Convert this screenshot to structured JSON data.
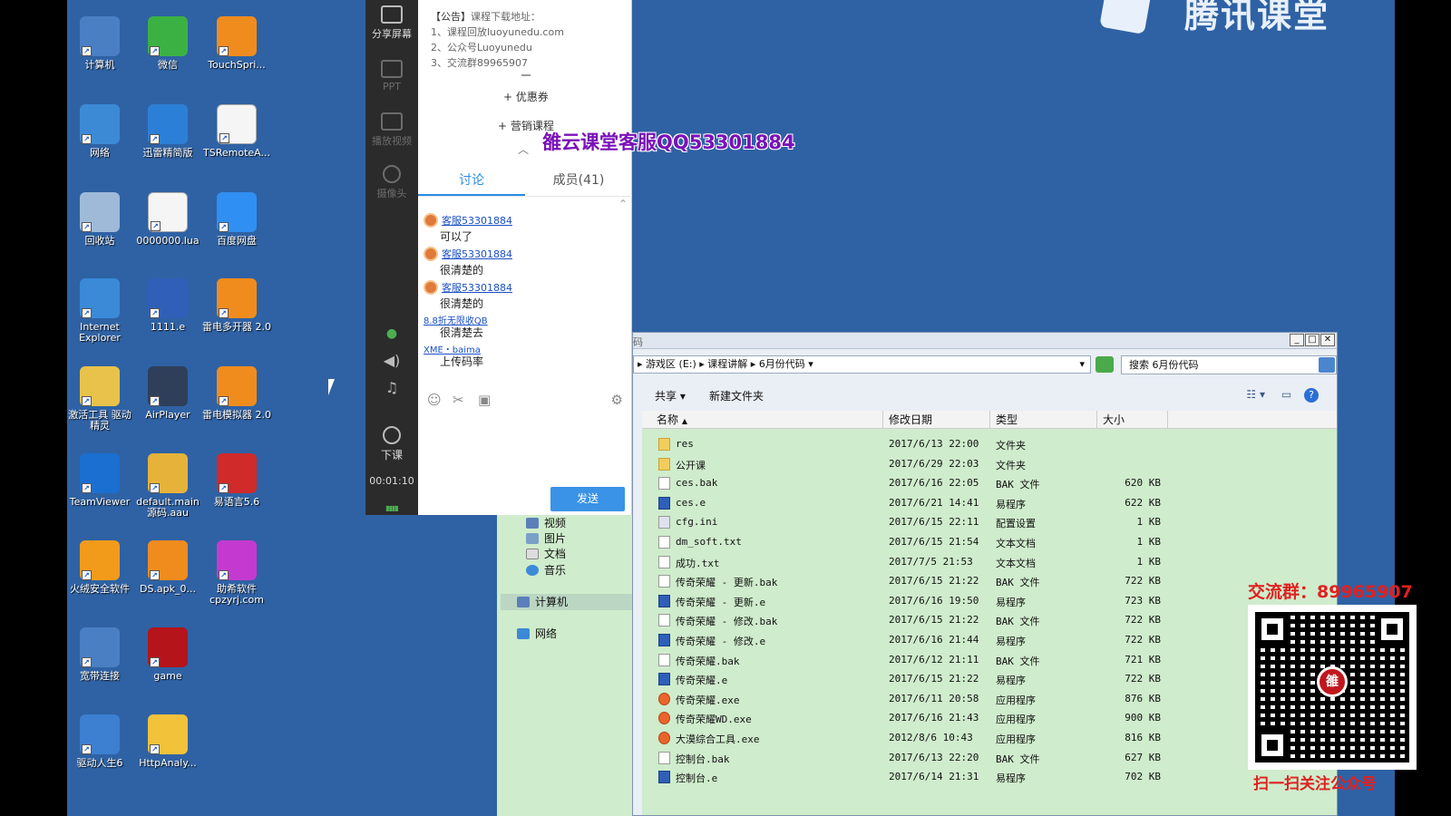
{
  "desktop": {
    "icons": [
      {
        "label": "计算机",
        "icon": "computer-icon",
        "color": "#4a7fc4"
      },
      {
        "label": "微信",
        "icon": "wechat-icon",
        "color": "#3bb143"
      },
      {
        "label": "TouchSpri...",
        "icon": "apk-icon",
        "color": "#f08c1e"
      },
      {
        "label": "网络",
        "icon": "network-icon",
        "color": "#3c8ad6"
      },
      {
        "label": "迅雷精简版",
        "icon": "thunder-icon",
        "color": "#2c7fd6"
      },
      {
        "label": "TSRemoteA...",
        "icon": "file-icon",
        "color": "#f5f5f5"
      },
      {
        "label": "回收站",
        "icon": "recycle-bin-icon",
        "color": "#9fb9d8"
      },
      {
        "label": "0000000.lua",
        "icon": "file-icon",
        "color": "#f5f5f5"
      },
      {
        "label": "百度网盘",
        "icon": "baidu-netdisk-icon",
        "color": "#2f8ff2"
      },
      {
        "label": "Internet Explorer",
        "icon": "ie-icon",
        "color": "#3a8ad8"
      },
      {
        "label": "1111.e",
        "icon": "e-lang-file-icon",
        "color": "#2f5fb8"
      },
      {
        "label": "雷电多开器 2.0",
        "icon": "leidian-multi-icon",
        "color": "#f08c1e"
      },
      {
        "label": "激活工具 驱动精灵",
        "icon": "folder-icon",
        "color": "#e8c24a"
      },
      {
        "label": "AirPlayer",
        "icon": "airplayer-icon",
        "color": "#2f3f5a"
      },
      {
        "label": "雷电模拟器 2.0",
        "icon": "leidian-emulator-icon",
        "color": "#f08c1e"
      },
      {
        "label": "TeamViewer",
        "icon": "teamviewer-icon",
        "color": "#1a6fd0"
      },
      {
        "label": "default.main 源码.aau",
        "icon": "aau-file-icon",
        "color": "#e6b23a"
      },
      {
        "label": "易语言5.6",
        "icon": "e-lang-icon",
        "color": "#d02a2a"
      },
      {
        "label": "火绒安全软件",
        "icon": "huorong-icon",
        "color": "#f29b1a"
      },
      {
        "label": "DS.apk_0...",
        "icon": "apk-icon",
        "color": "#f08c1e"
      },
      {
        "label": "助希软件 cpzyrj.com",
        "icon": "zhuxi-icon",
        "color": "#c43ad0"
      },
      {
        "label": "宽带连接",
        "icon": "broadband-icon",
        "color": "#4a7fc4"
      },
      {
        "label": "game",
        "icon": "game-icon",
        "color": "#b4141a"
      },
      {
        "label": "驱动人生6",
        "icon": "driver-life-icon",
        "color": "#3d7fd0"
      },
      {
        "label": "HttpAnaly...",
        "icon": "httpanalyzer-icon",
        "color": "#f2c23a"
      }
    ],
    "logo_text": "腾讯课堂",
    "watermark": "雒云课堂客服QQ53301884"
  },
  "toolbar": {
    "share_screen": "分享屏幕",
    "ppt": "PPT",
    "play_video": "播放视频",
    "camera": "摄像头",
    "end_class": "下课",
    "timer": "00:01:10"
  },
  "chat": {
    "announcement": {
      "head": "【公告】",
      "head_rest": "课程下载地址：",
      "line1": "1、课程回放luoyunedu.com",
      "line2": "2、公众号Luoyunedu",
      "line3": "3、交流群89965907"
    },
    "coupon": "+ 优惠券",
    "marketing": "+ 营销课程",
    "tab_discuss": "讨论",
    "tab_members": "成员(41)",
    "messages": [
      {
        "author": "客服53301884",
        "text": "可以了"
      },
      {
        "author": "客服53301884",
        "text": "很清楚的"
      },
      {
        "author": "客服53301884",
        "text": "很清楚的"
      }
    ],
    "extra": [
      {
        "link": "8.8折无限收QB",
        "text": "很清楚去"
      },
      {
        "link": "XME・baima",
        "text": "上传码率"
      }
    ],
    "send": "发送"
  },
  "explorer": {
    "title": "码",
    "address": [
      "游戏区 (E:)",
      "课程讲解",
      "6月份代码"
    ],
    "search_placeholder": "搜索 6月份代码",
    "cmd_share": "共享 ▾",
    "cmd_new_folder": "新建文件夹",
    "columns": [
      "名称",
      "修改日期",
      "类型",
      "大小"
    ],
    "nav": [
      {
        "label": "视频"
      },
      {
        "label": "图片"
      },
      {
        "label": "文档"
      },
      {
        "label": "音乐"
      },
      {
        "label": "计算机"
      },
      {
        "label": "网络"
      }
    ],
    "files": [
      {
        "name": "res",
        "date": "2017/6/13 22:00",
        "type": "文件夹",
        "size": "",
        "kind": "folder"
      },
      {
        "name": "公开课",
        "date": "2017/6/29 22:03",
        "type": "文件夹",
        "size": "",
        "kind": "folder"
      },
      {
        "name": "ces.bak",
        "date": "2017/6/16 22:05",
        "type": "BAK 文件",
        "size": "620 KB",
        "kind": "file"
      },
      {
        "name": "ces.e",
        "date": "2017/6/21 14:41",
        "type": "易程序",
        "size": "622 KB",
        "kind": "e"
      },
      {
        "name": "cfg.ini",
        "date": "2017/6/15 22:11",
        "type": "配置设置",
        "size": "1 KB",
        "kind": "ini"
      },
      {
        "name": "dm_soft.txt",
        "date": "2017/6/15 21:54",
        "type": "文本文档",
        "size": "1 KB",
        "kind": "file"
      },
      {
        "name": "成功.txt",
        "date": "2017/7/5 21:53",
        "type": "文本文档",
        "size": "1 KB",
        "kind": "file"
      },
      {
        "name": "传奇荣耀 - 更新.bak",
        "date": "2017/6/15 21:22",
        "type": "BAK 文件",
        "size": "722 KB",
        "kind": "file"
      },
      {
        "name": "传奇荣耀 - 更新.e",
        "date": "2017/6/16 19:50",
        "type": "易程序",
        "size": "723 KB",
        "kind": "e"
      },
      {
        "name": "传奇荣耀 - 修改.bak",
        "date": "2017/6/15 21:22",
        "type": "BAK 文件",
        "size": "722 KB",
        "kind": "file"
      },
      {
        "name": "传奇荣耀 - 修改.e",
        "date": "2017/6/16 21:44",
        "type": "易程序",
        "size": "722 KB",
        "kind": "e"
      },
      {
        "name": "传奇荣耀.bak",
        "date": "2017/6/12 21:11",
        "type": "BAK 文件",
        "size": "721 KB",
        "kind": "file"
      },
      {
        "name": "传奇荣耀.e",
        "date": "2017/6/15 21:22",
        "type": "易程序",
        "size": "722 KB",
        "kind": "e"
      },
      {
        "name": "传奇荣耀.exe",
        "date": "2017/6/11 20:58",
        "type": "应用程序",
        "size": "876 KB",
        "kind": "exe"
      },
      {
        "name": "传奇荣耀WD.exe",
        "date": "2017/6/16 21:43",
        "type": "应用程序",
        "size": "900 KB",
        "kind": "exe"
      },
      {
        "name": "大漠综合工具.exe",
        "date": "2012/8/6 10:43",
        "type": "应用程序",
        "size": "816 KB",
        "kind": "exe"
      },
      {
        "name": "控制台.bak",
        "date": "2017/6/13 22:20",
        "type": "BAK 文件",
        "size": "627 KB",
        "kind": "file"
      },
      {
        "name": "控制台.e",
        "date": "2017/6/14 21:31",
        "type": "易程序",
        "size": "702 KB",
        "kind": "e"
      }
    ]
  },
  "ad": {
    "group": "交流群：89965907",
    "qr_logo": "雒",
    "caption": "扫一扫关注公众号"
  }
}
